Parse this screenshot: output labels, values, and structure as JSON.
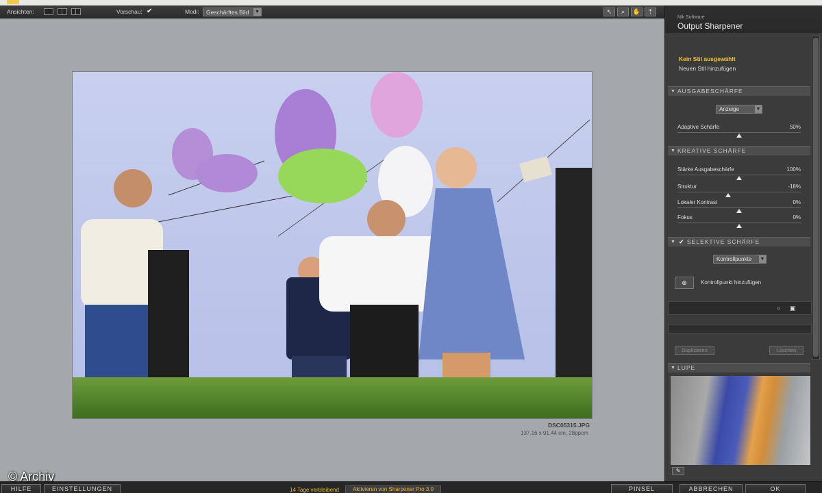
{
  "toolbar": {
    "views_label": "Ansichten:",
    "preview_label": "Vorschau:",
    "preview_checked": "✔",
    "mode_label": "Modi:",
    "mode_value": "Geschärftes Bild"
  },
  "preview": {
    "file_name": "DSC05315.JPG",
    "file_dims": "137.16 x 91.44 cm, 28ppcm"
  },
  "sidebar": {
    "vendor": "Nik Software",
    "product": "Output Sharpener",
    "style_selected": "Kein Stil ausgewählt",
    "style_add": "Neuen Stil hinzufügen",
    "sections": {
      "output": {
        "title": "AUSGABESCHÄRFE",
        "select": "Anzeige",
        "sliders": [
          {
            "label": "Adaptive Schärfe",
            "value": "50%",
            "pos": 0.5
          }
        ]
      },
      "creative": {
        "title": "KREATIVE SCHÄRFE",
        "sliders": [
          {
            "label": "Stärke Ausgabeschärfe",
            "value": "100%",
            "pos": 0.5
          },
          {
            "label": "Struktur",
            "value": "-18%",
            "pos": 0.41
          },
          {
            "label": "Lokaler Kontrast",
            "value": "0%",
            "pos": 0.5
          },
          {
            "label": "Fokus",
            "value": "0%",
            "pos": 0.5
          }
        ]
      },
      "selective": {
        "title": "SELEKTIVE SCHÄRFE",
        "checked": "✔",
        "select": "Kontrollpunkte",
        "add_point": "Kontrollpunkt hinzufügen",
        "btn_duplicate": "Duplizieren",
        "btn_delete": "Löschen"
      },
      "loupe": {
        "title": "LUPE"
      }
    }
  },
  "bottombar": {
    "help": "HILFE",
    "settings": "EINSTELLUNGEN",
    "remaining": "14 Tage verbleibend",
    "activate": "Aktivieren von Sharpener Pro 3.0",
    "brush": "PINSEL",
    "cancel": "ABBRECHEN",
    "ok": "OK"
  },
  "watermark": "© Archiv"
}
